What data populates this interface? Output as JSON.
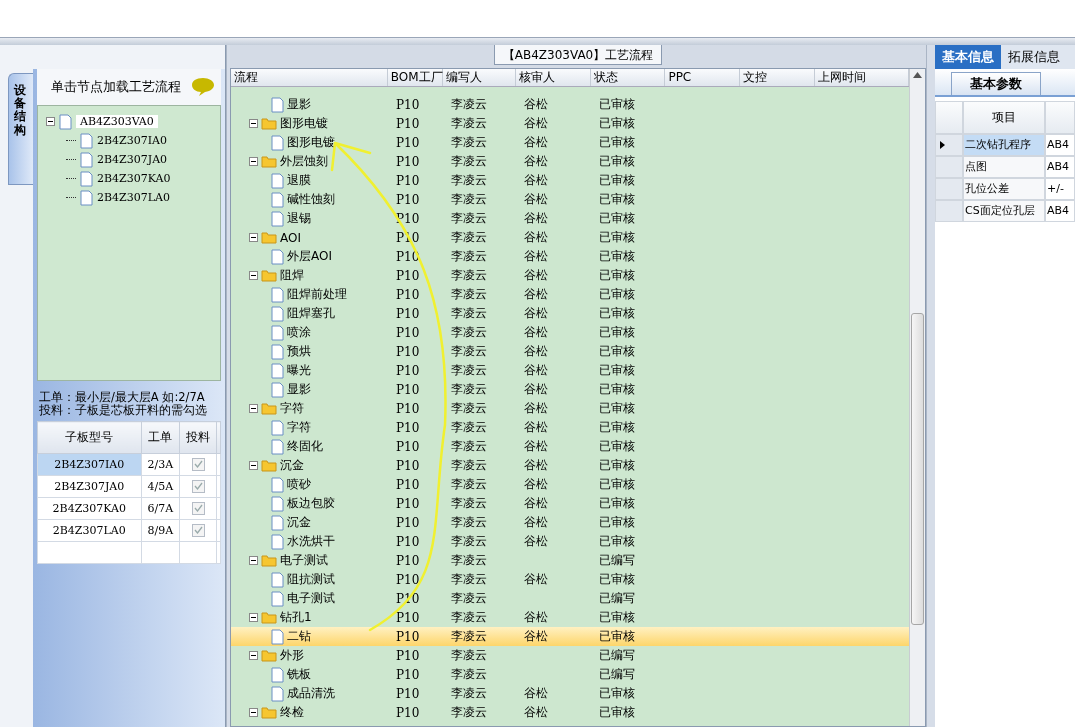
{
  "flow_title": "【AB4Z303VA0】工艺流程",
  "left_panel": {
    "side_tab": "设备结构",
    "header": "单击节点加载工艺流程",
    "tree": {
      "label": "AB4Z303VA0",
      "expanded": true,
      "children": [
        {
          "label": "2B4Z307IA0"
        },
        {
          "label": "2B4Z307JA0"
        },
        {
          "label": "2B4Z307KA0"
        },
        {
          "label": "2B4Z307LA0"
        }
      ]
    },
    "notes": [
      "工单：最小层/最大层A 如:2/7A",
      "投料：子板是芯板开料的需勾选"
    ],
    "table": {
      "columns": [
        "子板型号",
        "工单",
        "投料"
      ],
      "rows": [
        {
          "model": "2B4Z307IA0",
          "order": "2/3A",
          "checked": true,
          "selected": true
        },
        {
          "model": "2B4Z307JA0",
          "order": "4/5A",
          "checked": true,
          "selected": false
        },
        {
          "model": "2B4Z307KA0",
          "order": "6/7A",
          "checked": true,
          "selected": false
        },
        {
          "model": "2B4Z307LA0",
          "order": "8/9A",
          "checked": true,
          "selected": false
        }
      ]
    }
  },
  "flow": {
    "columns": [
      "流程",
      "BOM工厂",
      "编写人",
      "核审人",
      "状态",
      "PPC",
      "文控",
      "上网时间"
    ],
    "rows": [
      {
        "kind": "step",
        "label": "显影",
        "bom": "P10",
        "writer": "李凌云",
        "reviewer": "谷松",
        "status": "已审核",
        "selected": false
      },
      {
        "kind": "group",
        "label": "图形电镀",
        "bom": "P10",
        "writer": "李凌云",
        "reviewer": "谷松",
        "status": "已审核",
        "selected": false,
        "children": [
          {
            "kind": "step",
            "label": "图形电镀",
            "bom": "P10",
            "writer": "李凌云",
            "reviewer": "谷松",
            "status": "已审核",
            "selected": false
          }
        ]
      },
      {
        "kind": "group",
        "label": "外层蚀刻",
        "bom": "P10",
        "writer": "李凌云",
        "reviewer": "谷松",
        "status": "已审核",
        "selected": false,
        "children": [
          {
            "kind": "step",
            "label": "退膜",
            "bom": "P10",
            "writer": "李凌云",
            "reviewer": "谷松",
            "status": "已审核",
            "selected": false
          },
          {
            "kind": "step",
            "label": "碱性蚀刻",
            "bom": "P10",
            "writer": "李凌云",
            "reviewer": "谷松",
            "status": "已审核",
            "selected": false
          },
          {
            "kind": "step",
            "label": "退锡",
            "bom": "P10",
            "writer": "李凌云",
            "reviewer": "谷松",
            "status": "已审核",
            "selected": false
          }
        ]
      },
      {
        "kind": "group",
        "label": "AOI",
        "bom": "P10",
        "writer": "李凌云",
        "reviewer": "谷松",
        "status": "已审核",
        "selected": false,
        "children": [
          {
            "kind": "step",
            "label": "外层AOI",
            "bom": "P10",
            "writer": "李凌云",
            "reviewer": "谷松",
            "status": "已审核",
            "selected": false
          }
        ]
      },
      {
        "kind": "group",
        "label": "阻焊",
        "bom": "P10",
        "writer": "李凌云",
        "reviewer": "谷松",
        "status": "已审核",
        "selected": false,
        "children": [
          {
            "kind": "step",
            "label": "阻焊前处理",
            "bom": "P10",
            "writer": "李凌云",
            "reviewer": "谷松",
            "status": "已审核",
            "selected": false
          },
          {
            "kind": "step",
            "label": "阻焊塞孔",
            "bom": "P10",
            "writer": "李凌云",
            "reviewer": "谷松",
            "status": "已审核",
            "selected": false
          },
          {
            "kind": "step",
            "label": "喷涂",
            "bom": "P10",
            "writer": "李凌云",
            "reviewer": "谷松",
            "status": "已审核",
            "selected": false
          },
          {
            "kind": "step",
            "label": "预烘",
            "bom": "P10",
            "writer": "李凌云",
            "reviewer": "谷松",
            "status": "已审核",
            "selected": false
          },
          {
            "kind": "step",
            "label": "曝光",
            "bom": "P10",
            "writer": "李凌云",
            "reviewer": "谷松",
            "status": "已审核",
            "selected": false
          },
          {
            "kind": "step",
            "label": "显影",
            "bom": "P10",
            "writer": "李凌云",
            "reviewer": "谷松",
            "status": "已审核",
            "selected": false
          }
        ]
      },
      {
        "kind": "group",
        "label": "字符",
        "bom": "P10",
        "writer": "李凌云",
        "reviewer": "谷松",
        "status": "已审核",
        "selected": false,
        "children": [
          {
            "kind": "step",
            "label": "字符",
            "bom": "P10",
            "writer": "李凌云",
            "reviewer": "谷松",
            "status": "已审核",
            "selected": false
          },
          {
            "kind": "step",
            "label": "终固化",
            "bom": "P10",
            "writer": "李凌云",
            "reviewer": "谷松",
            "status": "已审核",
            "selected": false
          }
        ]
      },
      {
        "kind": "group",
        "label": "沉金",
        "bom": "P10",
        "writer": "李凌云",
        "reviewer": "谷松",
        "status": "已审核",
        "selected": false,
        "children": [
          {
            "kind": "step",
            "label": "喷砂",
            "bom": "P10",
            "writer": "李凌云",
            "reviewer": "谷松",
            "status": "已审核",
            "selected": false
          },
          {
            "kind": "step",
            "label": "板边包胶",
            "bom": "P10",
            "writer": "李凌云",
            "reviewer": "谷松",
            "status": "已审核",
            "selected": false
          },
          {
            "kind": "step",
            "label": "沉金",
            "bom": "P10",
            "writer": "李凌云",
            "reviewer": "谷松",
            "status": "已审核",
            "selected": false
          },
          {
            "kind": "step",
            "label": "水洗烘干",
            "bom": "P10",
            "writer": "李凌云",
            "reviewer": "谷松",
            "status": "已审核",
            "selected": false
          }
        ]
      },
      {
        "kind": "group",
        "label": "电子测试",
        "bom": "P10",
        "writer": "李凌云",
        "status": "已编写",
        "selected": false,
        "children": [
          {
            "kind": "step",
            "label": "阻抗测试",
            "bom": "P10",
            "writer": "李凌云",
            "reviewer": "谷松",
            "status": "已审核",
            "selected": false
          },
          {
            "kind": "step",
            "label": "电子测试",
            "bom": "P10",
            "writer": "李凌云",
            "status": "已编写",
            "selected": false
          }
        ]
      },
      {
        "kind": "group",
        "label": "钻孔1",
        "bom": "P10",
        "writer": "李凌云",
        "reviewer": "谷松",
        "status": "已审核",
        "selected": false,
        "children": [
          {
            "kind": "step",
            "label": "二钻",
            "bom": "P10",
            "writer": "李凌云",
            "reviewer": "谷松",
            "status": "已审核",
            "selected": true
          }
        ]
      },
      {
        "kind": "group",
        "label": "外形",
        "bom": "P10",
        "writer": "李凌云",
        "status": "已编写",
        "selected": false,
        "children": [
          {
            "kind": "step",
            "label": "铣板",
            "bom": "P10",
            "writer": "李凌云",
            "status": "已编写",
            "selected": false
          },
          {
            "kind": "step",
            "label": "成品清洗",
            "bom": "P10",
            "writer": "李凌云",
            "reviewer": "谷松",
            "status": "已审核",
            "selected": false
          }
        ]
      },
      {
        "kind": "group",
        "label": "终检",
        "bom": "P10",
        "writer": "李凌云",
        "reviewer": "谷松",
        "status": "已审核",
        "selected": false
      }
    ]
  },
  "right_panel": {
    "tabs": [
      {
        "label": "基本信息",
        "selected": true
      },
      {
        "label": "拓展信息",
        "selected": false
      }
    ],
    "sub_tab": "基本参数",
    "column": "项目",
    "rows": [
      {
        "item": "二次钻孔程序",
        "value": "AB4",
        "selected": true
      },
      {
        "item": "点图",
        "value": "AB4",
        "selected": false
      },
      {
        "item": "孔位公差",
        "value": "+/-",
        "selected": false
      },
      {
        "item": "CS面定位孔层",
        "value": "AB4",
        "selected": false
      }
    ]
  }
}
